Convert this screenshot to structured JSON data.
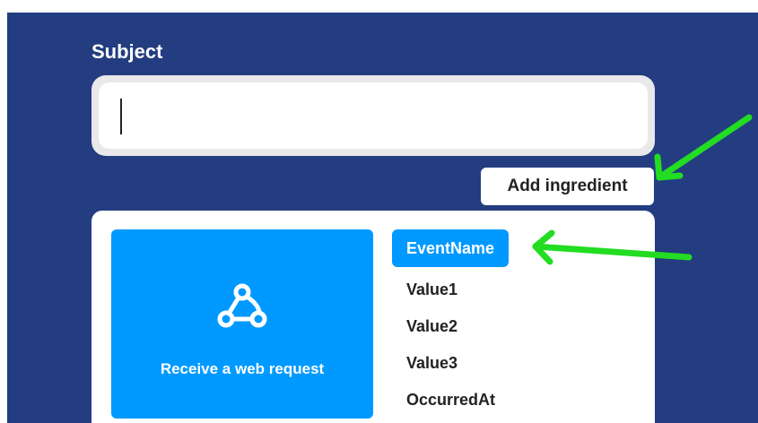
{
  "form": {
    "subject_label": "Subject",
    "subject_value": "",
    "add_ingredient_label": "Add ingredient"
  },
  "service": {
    "name": "Receive a web request",
    "icon": "webhook-icon",
    "color": "#0099ff"
  },
  "ingredients": [
    {
      "label": "EventName",
      "selected": true
    },
    {
      "label": "Value1",
      "selected": false
    },
    {
      "label": "Value2",
      "selected": false
    },
    {
      "label": "Value3",
      "selected": false
    },
    {
      "label": "OccurredAt",
      "selected": false
    }
  ],
  "colors": {
    "background": "#233d80",
    "accent": "#0099ff",
    "annotation_arrow": "#22dd22"
  }
}
